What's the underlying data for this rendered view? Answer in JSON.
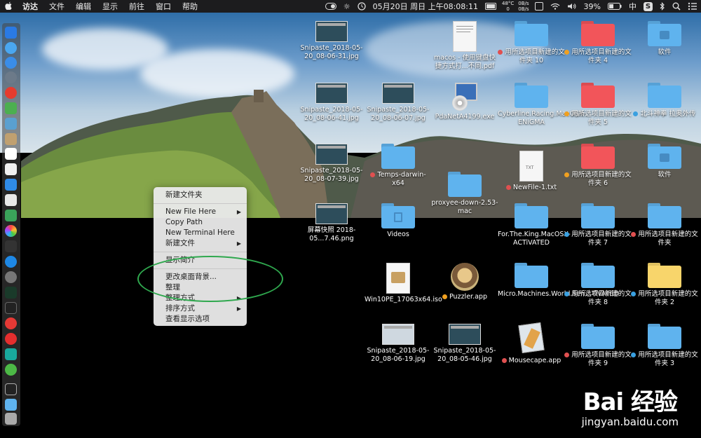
{
  "menubar": {
    "apple": "",
    "items": [
      "访达",
      "文件",
      "编辑",
      "显示",
      "前往",
      "窗口",
      "帮助"
    ],
    "datetime": "05月20日 周日 上午08:08:11",
    "temp": "48°C",
    "temp2": "0",
    "net_up": "0B/s",
    "net_down": "0B/s",
    "battery": "39%",
    "ime": "中",
    "wps": "S"
  },
  "desktop": {
    "icons": [
      {
        "label": "Snipaste_2018-05-20_08-06-31.jpg",
        "type": "thumb"
      },
      {
        "label": "macos - 使用键盘快捷方式打...不同.pdf",
        "type": "doc"
      },
      {
        "label": "用所选项目新建的文件夹 10",
        "type": "folder",
        "tag": "#e05050"
      },
      {
        "label": "用所选项目新建的文件夹 4",
        "type": "folder-red",
        "tag": "#f0a020"
      },
      {
        "label": "软件",
        "type": "folder-box"
      },
      {
        "label": "Snipaste_2018-05-20_08-06-41.jpg",
        "type": "thumb"
      },
      {
        "label": "Snipaste_2018-05-20_08-06-07.jpg",
        "type": "thumb"
      },
      {
        "label": "PdaNetA4199.exe",
        "type": "exe"
      },
      {
        "label": "Cyberline.Racing.MacOSX-ENiGMA",
        "type": "folder"
      },
      {
        "label": "用所选项目新建的文件夹 5",
        "type": "folder-red",
        "tag": "#f0a020"
      },
      {
        "label": "北斗神拳 拉奥外传",
        "type": "folder",
        "tag": "#3aa0e0"
      },
      {
        "label": "Snipaste_2018-05-20_08-07-39.jpg",
        "type": "thumb"
      },
      {
        "label": "Temps-darwin-x64",
        "type": "folder",
        "tag": "#e05050"
      },
      {
        "label": "NewFile-1.txt",
        "type": "txt",
        "tag": "#e05050"
      },
      {
        "label": "用所选项目新建的文件夹 6",
        "type": "folder-red",
        "tag": "#f0a020"
      },
      {
        "label": "软件",
        "type": "folder-box"
      },
      {
        "label": "proxyee-down-2.53-mac",
        "type": "folder"
      },
      {
        "label": "屏幕快照 2018-05...7.46.png",
        "type": "thumb"
      },
      {
        "label": "Videos",
        "type": "folder-video"
      },
      {
        "label": "For.The.King.MacOSX-ACTiVATED",
        "type": "folder"
      },
      {
        "label": "用所选项目新建的文件夹 7",
        "type": "folder",
        "tag": "#3aa0e0"
      },
      {
        "label": "用所选项目新建的文件夹",
        "type": "folder",
        "tag": "#e05050"
      },
      {
        "label": "Win10PE_17063x64.iso",
        "type": "iso"
      },
      {
        "label": "Puzzler.app",
        "type": "app",
        "tag": "#f0a020"
      },
      {
        "label": "Micro.Machines.World.Seri...TiVATED",
        "type": "folder"
      },
      {
        "label": "用所选项目新建的文件夹 8",
        "type": "folder",
        "tag": "#3aa0e0"
      },
      {
        "label": "用所选项目新建的文件夹 2",
        "type": "folder-yellow",
        "tag": "#3aa0e0"
      },
      {
        "label": "Snipaste_2018-05-20_08-06-19.jpg",
        "type": "thumb-light"
      },
      {
        "label": "Snipaste_2018-05-20_08-05-46.jpg",
        "type": "thumb"
      },
      {
        "label": "Mousecape.app",
        "type": "mouse",
        "tag": "#e05050"
      },
      {
        "label": "用所选项目新建的文件夹 9",
        "type": "folder",
        "tag": "#e05050"
      },
      {
        "label": "用所选项目新建的文件夹 3",
        "type": "folder",
        "tag": "#3aa0e0"
      }
    ]
  },
  "context_menu": {
    "new_folder": "新建文件夹",
    "new_file_here": "New File Here",
    "copy_path": "Copy Path",
    "new_terminal_here": "New Terminal Here",
    "new_file": "新建文件",
    "get_info": "显示简介",
    "change_bg": "更改桌面背景...",
    "clean_up": "整理",
    "clean_up_by": "整理方式",
    "sort_by": "排序方式",
    "view_options": "查看显示选项"
  },
  "watermark": {
    "logo": "Bai 经验",
    "url": "jingyan.baidu.com"
  },
  "colors": {
    "folder_blue": "#5fb3ee",
    "folder_red": "#f2555a",
    "folder_yellow": "#f8d56b",
    "highlight_ellipse": "#2fa84e"
  }
}
